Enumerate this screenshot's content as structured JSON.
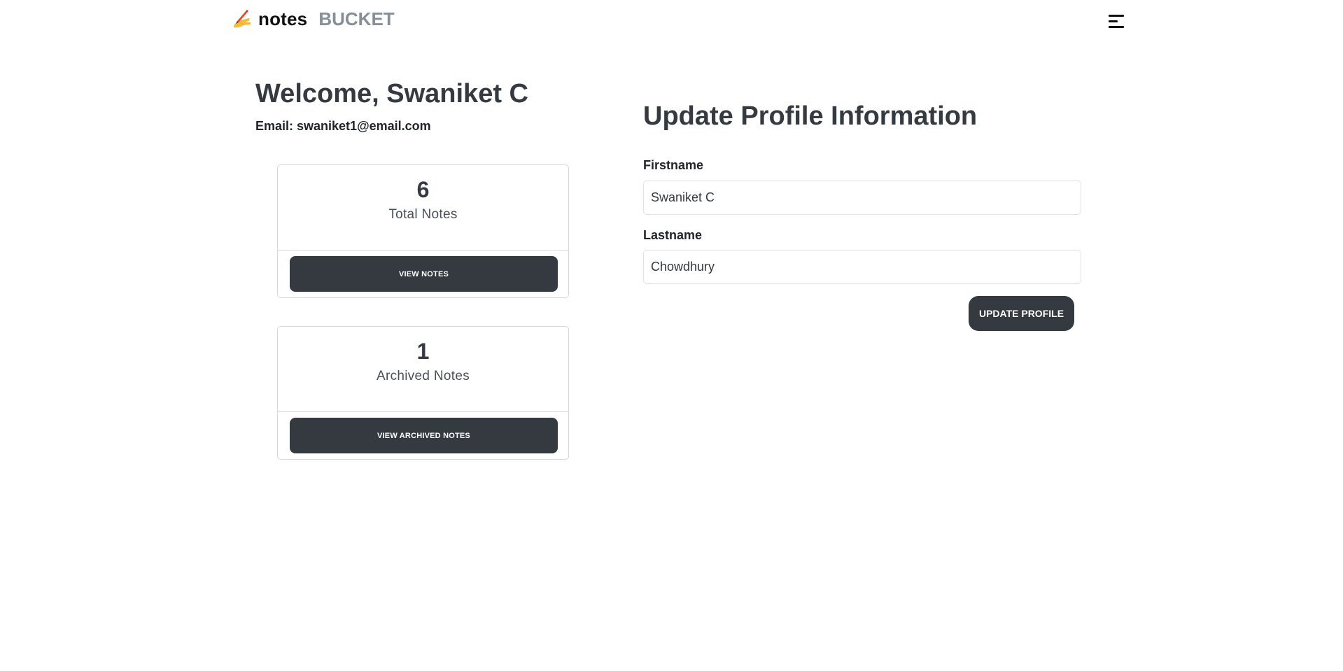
{
  "navbar": {
    "brand_icon": "writing-hand-icon",
    "brand_name": "notes",
    "brand_accent": "BUCKET",
    "menu_icon": "hamburger-menu-icon"
  },
  "profile": {
    "welcome": "Welcome, Swaniket C",
    "email_label": "Email: swaniket1@email.com"
  },
  "stats": [
    {
      "count": "6",
      "label": "Total Notes",
      "button": "VIEW NOTES"
    },
    {
      "count": "1",
      "label": "Archived Notes",
      "button": "VIEW ARCHIVED NOTES"
    }
  ],
  "form": {
    "title": "Update Profile Information",
    "firstname_label": "Firstname",
    "firstname_value": "Swaniket C",
    "lastname_label": "Lastname",
    "lastname_value": "Chowdhury",
    "submit_label": "UPDATE PROFILE"
  },
  "colors": {
    "primary_dark": "#343a40",
    "accent_gray": "#868e96",
    "border": "#d6d8db"
  }
}
